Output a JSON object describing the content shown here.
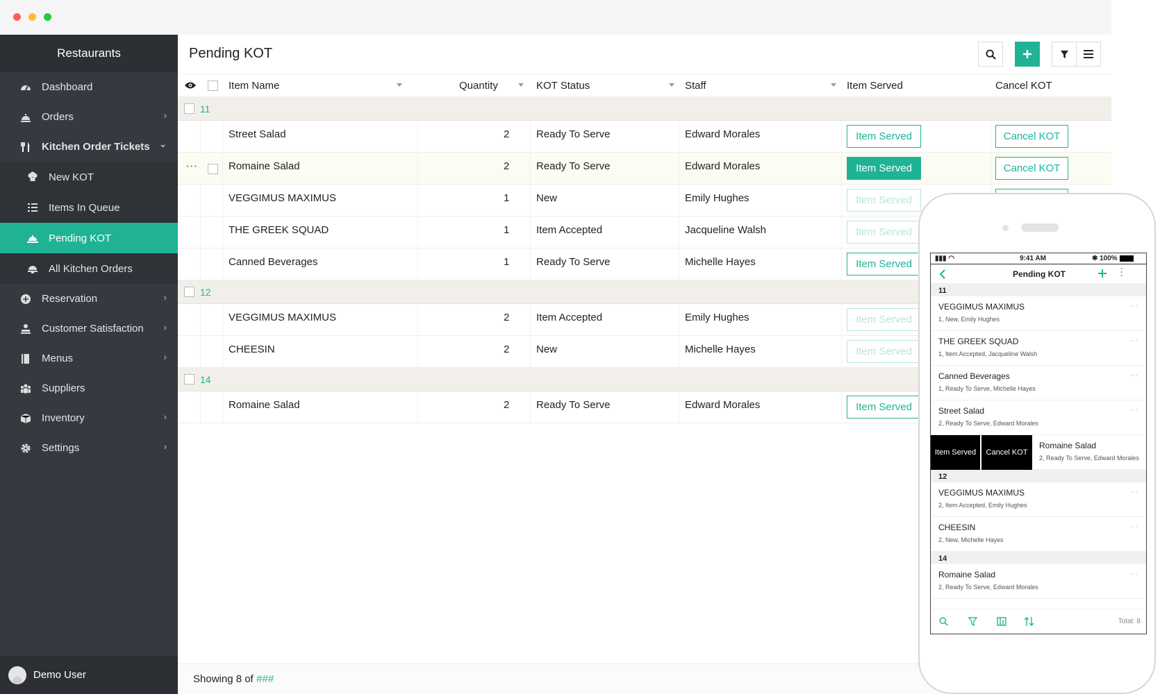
{
  "window": {
    "dots": [
      "#fd5f57",
      "#fdbd2e",
      "#28c840"
    ]
  },
  "sidebar": {
    "brand": "Restaurants",
    "items": [
      {
        "label": "Dashboard",
        "icon": "dashboard-icon",
        "chevron": ""
      },
      {
        "label": "Orders",
        "icon": "orders-icon",
        "chevron": "›"
      },
      {
        "label": "Kitchen Order Tickets",
        "icon": "utensils-icon",
        "chevron": "⌄"
      },
      {
        "label": "New KOT",
        "icon": "chef-hat-icon",
        "chevron": ""
      },
      {
        "label": "Items In Queue",
        "icon": "list-icon",
        "chevron": ""
      },
      {
        "label": "Pending KOT",
        "icon": "serving-tray-icon",
        "chevron": ""
      },
      {
        "label": "All Kitchen Orders",
        "icon": "cloche-icon",
        "chevron": ""
      },
      {
        "label": "Reservation",
        "icon": "reservation-icon",
        "chevron": "›"
      },
      {
        "label": "Customer Satisfaction",
        "icon": "satisfaction-icon",
        "chevron": "›"
      },
      {
        "label": "Menus",
        "icon": "menu-book-icon",
        "chevron": "›"
      },
      {
        "label": "Suppliers",
        "icon": "suppliers-icon",
        "chevron": ""
      },
      {
        "label": "Inventory",
        "icon": "inventory-box-icon",
        "chevron": "›"
      },
      {
        "label": "Settings",
        "icon": "gear-icon",
        "chevron": "›"
      }
    ],
    "user": "Demo User"
  },
  "main": {
    "title": "Pending KOT",
    "columns": {
      "item": "Item Name",
      "qty": "Quantity",
      "status": "KOT Status",
      "staff": "Staff",
      "served": "Item Served",
      "cancel": "Cancel KOT"
    },
    "buttons": {
      "served": "Item Served",
      "cancel": "Cancel KOT"
    },
    "groups": [
      {
        "id": "11",
        "rows": [
          {
            "item": "Street Salad",
            "qty": "2",
            "status": "Ready To Serve",
            "staff": "Edward Morales"
          },
          {
            "item": "Romaine Salad",
            "qty": "2",
            "status": "Ready To Serve",
            "staff": "Edward Morales"
          },
          {
            "item": "VEGGIMUS MAXIMUS",
            "qty": "1",
            "status": "New",
            "staff": "Emily Hughes"
          },
          {
            "item": "THE GREEK SQUAD",
            "qty": "1",
            "status": "Item Accepted",
            "staff": "Jacqueline Walsh"
          },
          {
            "item": "Canned Beverages",
            "qty": "1",
            "status": "Ready To Serve",
            "staff": "Michelle Hayes"
          }
        ]
      },
      {
        "id": "12",
        "rows": [
          {
            "item": "VEGGIMUS MAXIMUS",
            "qty": "2",
            "status": "Item Accepted",
            "staff": "Emily Hughes"
          },
          {
            "item": "CHEESIN",
            "qty": "2",
            "status": "New",
            "staff": "Michelle Hayes"
          }
        ]
      },
      {
        "id": "14",
        "rows": [
          {
            "item": "Romaine Salad",
            "qty": "2",
            "status": "Ready To Serve",
            "staff": "Edward Morales"
          }
        ]
      }
    ],
    "footer": {
      "prefix": "Showing 8 of ",
      "total": "###"
    }
  },
  "phone": {
    "status": {
      "time": "9:41 AM",
      "battery": "100%"
    },
    "title": "Pending KOT",
    "groups": [
      "11",
      "12",
      "14"
    ],
    "items": [
      {
        "name": "VEGGIMUS MAXIMUS",
        "sub": "1, New, Emily Hughes"
      },
      {
        "name": "THE GREEK SQUAD",
        "sub": "1, Item Accepted, Jacqueline Walsh"
      },
      {
        "name": "Canned Beverages",
        "sub": "1, Ready To Serve, Michelle Hayes"
      },
      {
        "name": "Street Salad",
        "sub": "2, Ready To Serve, Edward Morales"
      },
      {
        "name": "Romaine Salad",
        "sub": "2, Ready To Serve, Edward Morales"
      },
      {
        "name": "VEGGIMUS MAXIMUS",
        "sub": "2, Item Accepted, Emily Hughes"
      },
      {
        "name": "CHEESIN",
        "sub": "2, New, Michelle Hayes"
      },
      {
        "name": "Romaine Salad",
        "sub": "2, Ready To Serve, Edward Morales"
      }
    ],
    "swipe": {
      "served": "Item Served",
      "cancel": "Cancel KOT"
    },
    "total": "Total: 8",
    "accent": "#1fb394"
  }
}
